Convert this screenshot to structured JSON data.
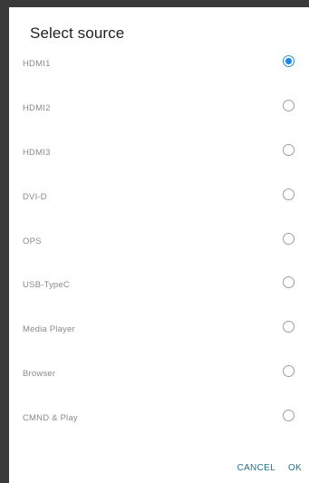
{
  "dialog": {
    "title": "Select source",
    "options": [
      {
        "label": "HDMI1",
        "selected": true
      },
      {
        "label": "HDMI2",
        "selected": false
      },
      {
        "label": "HDMI3",
        "selected": false
      },
      {
        "label": "DVI-D",
        "selected": false
      },
      {
        "label": "OPS",
        "selected": false
      },
      {
        "label": "USB-TypeC",
        "selected": false
      },
      {
        "label": "Media Player",
        "selected": false
      },
      {
        "label": "Browser",
        "selected": false
      },
      {
        "label": "CMND & Play",
        "selected": false
      }
    ],
    "cancel_label": "CANCEL",
    "ok_label": "OK"
  },
  "colors": {
    "accent": "#1e88e5",
    "button_text": "#1f6f87",
    "frame": "#3a3a3a"
  }
}
